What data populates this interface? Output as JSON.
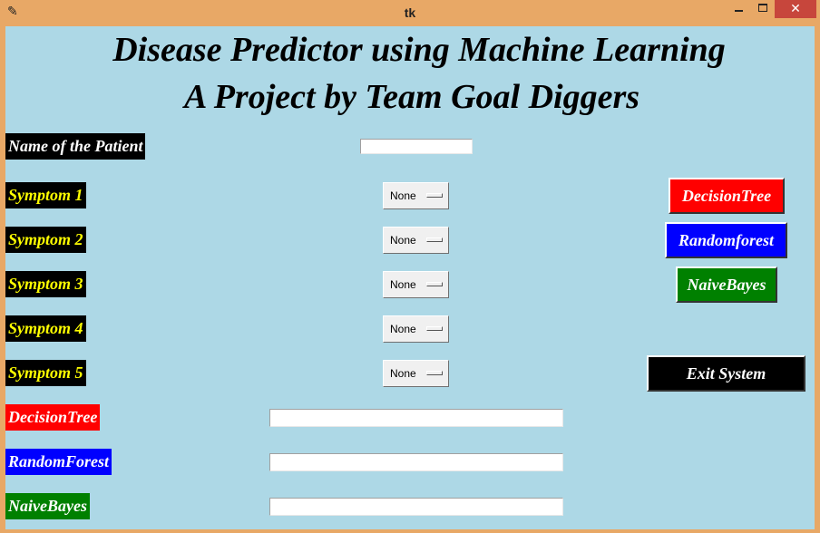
{
  "window": {
    "title": "tk",
    "icon": "feather-icon",
    "close_glyph": "✕"
  },
  "heading": {
    "line1": "Disease Predictor using Machine Learning",
    "line2": "A Project by Team Goal Diggers"
  },
  "patient": {
    "label": "Name of the Patient",
    "value": ""
  },
  "symptoms": [
    {
      "label": "Symptom 1",
      "value": "None"
    },
    {
      "label": "Symptom 2",
      "value": "None"
    },
    {
      "label": "Symptom 3",
      "value": "None"
    },
    {
      "label": "Symptom 4",
      "value": "None"
    },
    {
      "label": "Symptom 5",
      "value": "None"
    }
  ],
  "buttons": {
    "decision_tree": "DecisionTree",
    "random_forest": "Randomforest",
    "naive_bayes": "NaiveBayes",
    "exit": "Exit System"
  },
  "results": [
    {
      "label": "DecisionTree",
      "value": ""
    },
    {
      "label": "RandomForest",
      "value": ""
    },
    {
      "label": "NaiveBayes",
      "value": ""
    }
  ],
  "colors": {
    "background": "#add8e6",
    "titlebar": "#e8a866",
    "symptom_text": "#ffff00",
    "decision_tree": "#ff0000",
    "random_forest": "#0000ff",
    "naive_bayes": "#008000",
    "exit": "#000000"
  }
}
